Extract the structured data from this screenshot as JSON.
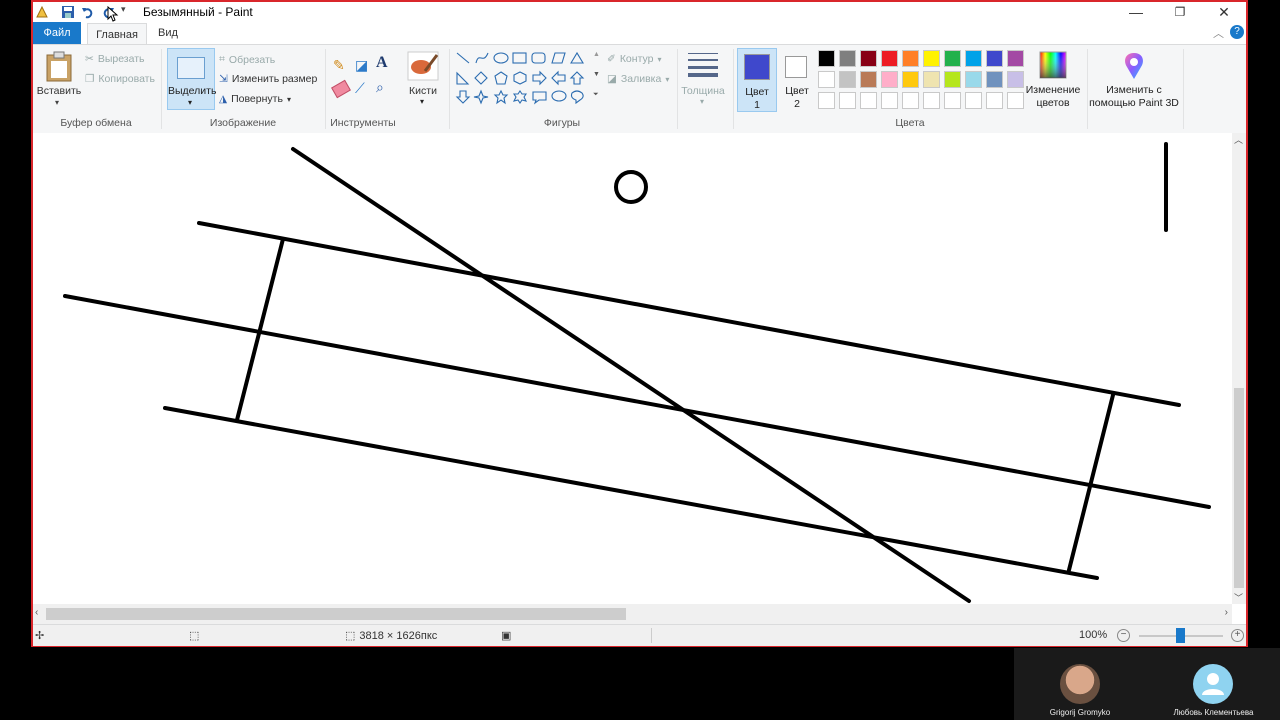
{
  "window": {
    "title": "Безымянный - Paint"
  },
  "tabs": {
    "file": "Файл",
    "home": "Главная",
    "view": "Вид"
  },
  "clipboard": {
    "paste": "Вставить",
    "cut": "Вырезать",
    "copy": "Копировать",
    "group": "Буфер обмена"
  },
  "image": {
    "select": "Выделить",
    "crop": "Обрезать",
    "resize": "Изменить размер",
    "rotate": "Повернуть",
    "group": "Изображение"
  },
  "tools": {
    "group": "Инструменты"
  },
  "brushes": {
    "label": "Кисти"
  },
  "shapes": {
    "outline": "Контур",
    "fill": "Заливка",
    "group": "Фигуры"
  },
  "size": {
    "label": "Толщина"
  },
  "colors": {
    "color1_label": "Цвет\n1",
    "color1_a": "Цвет",
    "color1_b": "1",
    "color2_a": "Цвет",
    "color2_b": "2",
    "color1": "#3f48cc",
    "color2": "#ffffff",
    "edit_a": "Изменение",
    "edit_b": "цветов",
    "group": "Цвета",
    "palette_row1": [
      "#000000",
      "#7f7f7f",
      "#880015",
      "#ed1c24",
      "#ff7f27",
      "#fff200",
      "#22b14c",
      "#00a2e8",
      "#3f48cc",
      "#a349a4"
    ],
    "palette_row2": [
      "#ffffff",
      "#c3c3c3",
      "#b97a57",
      "#ffaec9",
      "#ffc90e",
      "#efe4b0",
      "#b5e61d",
      "#99d9ea",
      "#7092be",
      "#c8bfe7"
    ]
  },
  "paint3d": {
    "line1": "Изменить с",
    "line2": "помощью Paint 3D"
  },
  "status": {
    "dimensions": "3818 × 1626пкс",
    "zoom": "100%"
  },
  "participants": [
    {
      "name": "Grigorij Gromyko"
    },
    {
      "name": "Любовь Клементьева"
    }
  ]
}
